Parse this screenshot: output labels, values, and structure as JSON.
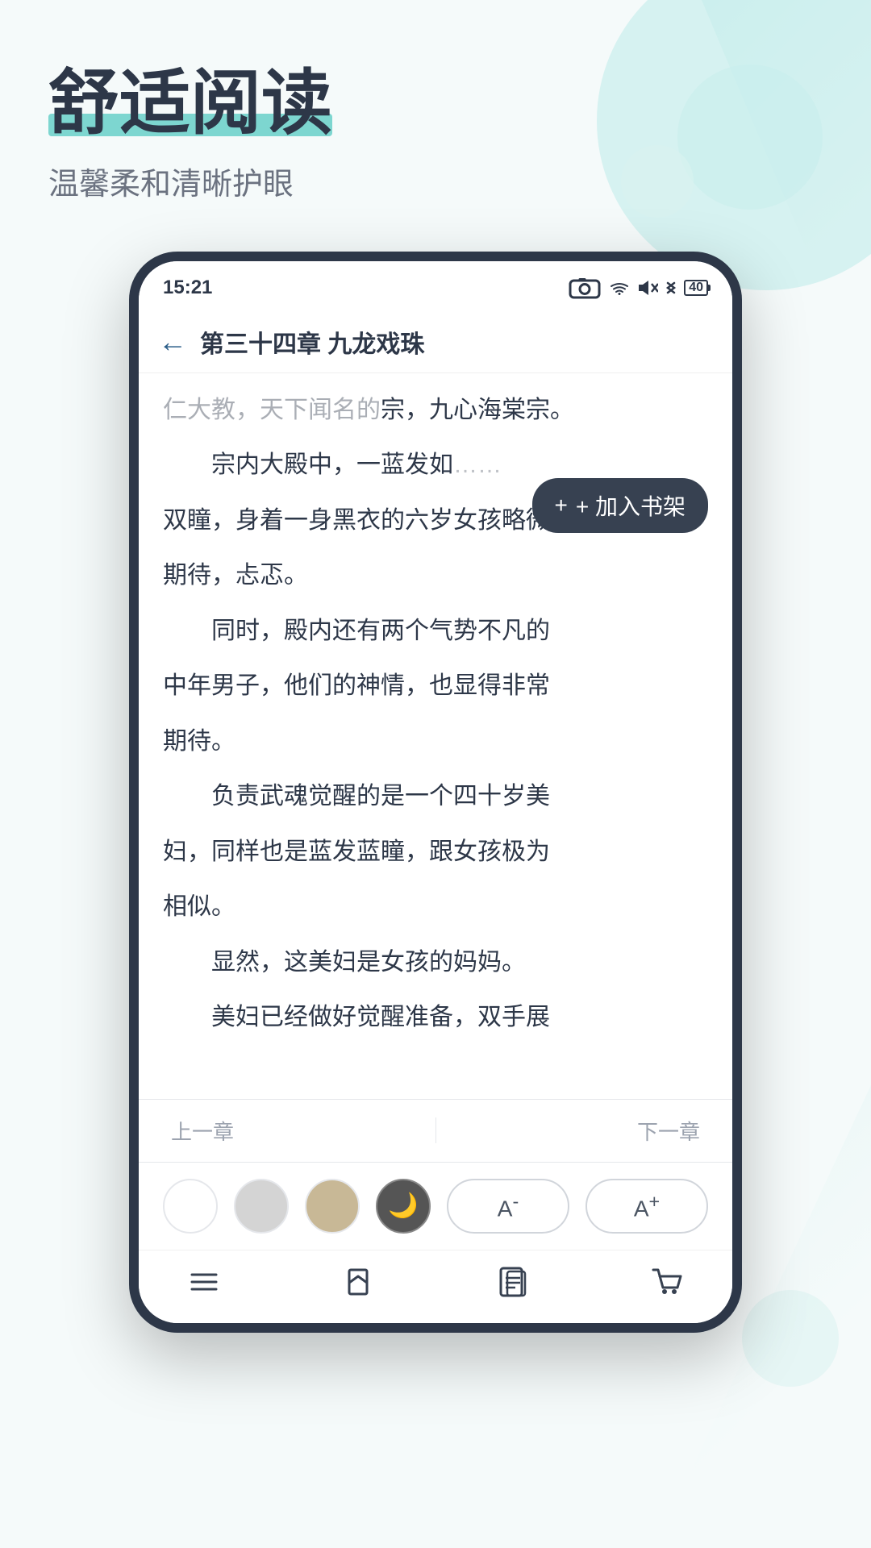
{
  "page": {
    "background_color": "#f5fafa"
  },
  "hero": {
    "title": "舒适阅读",
    "title_highlight": "舒适阅读",
    "subtitle": "温馨柔和清晰护眼"
  },
  "phone": {
    "status_bar": {
      "time": "15:21",
      "icons": [
        "📷",
        "📶",
        "🔇",
        "🔵",
        "40"
      ]
    },
    "reader": {
      "chapter_title": "第三十四章 九龙戏珠",
      "back_label": "←",
      "content_lines": [
        {
          "text": "宗，九心海棠宗。",
          "indent": false
        },
        {
          "text": "宗内大殿中，一蓝发如",
          "indent": true
        },
        {
          "text": "双瞳，身着一身黑衣的六岁女孩略微",
          "indent": false
        },
        {
          "text": "期待，忐忑。",
          "indent": false
        },
        {
          "text": "同时，殿内还有两个气势不凡的",
          "indent": true
        },
        {
          "text": "中年男子，他们的神情，也显得非常",
          "indent": false
        },
        {
          "text": "期待。",
          "indent": false
        },
        {
          "text": "负责武魂觉醒的是一个四十岁美",
          "indent": true
        },
        {
          "text": "妇，同样也是蓝发蓝瞳，跟女孩极为",
          "indent": false
        },
        {
          "text": "相似。",
          "indent": false
        },
        {
          "text": "显然，这美妇是女孩的妈妈。",
          "indent": true
        },
        {
          "text": "美妇已经做好觉醒准备，双手展",
          "indent": true
        }
      ],
      "add_shelf_label": "+ 加入书架",
      "chapter_nav": {
        "prev": "上一章",
        "next": "下一章"
      },
      "settings": {
        "themes": [
          "white",
          "light-gray",
          "warm",
          "night"
        ],
        "font_decrease": "A⁻",
        "font_increase": "A⁺"
      },
      "bottom_nav": {
        "items": [
          "目录",
          "书签",
          "章节",
          "购物车"
        ]
      }
    }
  }
}
